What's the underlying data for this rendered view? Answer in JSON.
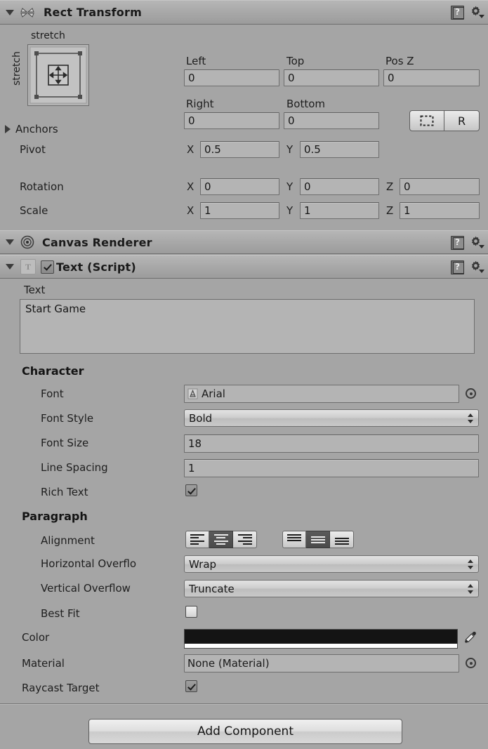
{
  "components": [
    {
      "id": "rect_transform",
      "title": "Rect Transform",
      "icon": "rect-transform-icon",
      "expanded": true,
      "help_icon": "help-book-icon",
      "gear_icon": "gear-icon"
    },
    {
      "id": "canvas_renderer",
      "title": "Canvas Renderer",
      "icon": "canvas-renderer-icon",
      "expanded": true,
      "help_icon": "help-book-icon",
      "gear_icon": "gear-icon"
    },
    {
      "id": "text_script",
      "title": "Text (Script)",
      "icon": "text-script-icon",
      "expanded": true,
      "enabled": true,
      "help_icon": "help-book-icon",
      "gear_icon": "gear-icon"
    }
  ],
  "rect_transform": {
    "anchor_preset": {
      "top_label": "stretch",
      "side_label": "stretch",
      "icon": "anchor-stretch-stretch-icon"
    },
    "left": {
      "label": "Left",
      "value": "0"
    },
    "top": {
      "label": "Top",
      "value": "0"
    },
    "pos_z": {
      "label": "Pos Z",
      "value": "0"
    },
    "right": {
      "label": "Right",
      "value": "0"
    },
    "bottom": {
      "label": "Bottom",
      "value": "0"
    },
    "blueprint_button": {
      "icon": "blueprint-rect-icon",
      "label": ""
    },
    "raw_button": {
      "label": "R"
    },
    "anchors": {
      "label": "Anchors",
      "expanded": false
    },
    "pivot": {
      "label": "Pivot",
      "x_axis": "X",
      "x": "0.5",
      "y_axis": "Y",
      "y": "0.5"
    },
    "rotation": {
      "label": "Rotation",
      "x_axis": "X",
      "x": "0",
      "y_axis": "Y",
      "y": "0",
      "z_axis": "Z",
      "z": "0"
    },
    "scale": {
      "label": "Scale",
      "x_axis": "X",
      "x": "1",
      "y_axis": "Y",
      "y": "1",
      "z_axis": "Z",
      "z": "1"
    }
  },
  "text_component": {
    "text_label": "Text",
    "text_value": "Start Game",
    "character_header": "Character",
    "font": {
      "label": "Font",
      "value": "Arial",
      "icon": "font-asset-icon",
      "picker_icon": "object-picker-icon"
    },
    "font_style": {
      "label": "Font Style",
      "value": "Bold",
      "dropdown_icon": "updown-arrow-icon"
    },
    "font_size": {
      "label": "Font Size",
      "value": "18"
    },
    "line_spacing": {
      "label": "Line Spacing",
      "value": "1"
    },
    "rich_text": {
      "label": "Rich Text",
      "checked": true
    },
    "paragraph_header": "Paragraph",
    "alignment": {
      "label": "Alignment",
      "horizontal_options": [
        "align-left",
        "align-center",
        "align-right"
      ],
      "horizontal_selected": 1,
      "vertical_options": [
        "align-top",
        "align-middle",
        "align-bottom"
      ],
      "vertical_selected": 1
    },
    "horizontal_overflow": {
      "label": "Horizontal Overflo",
      "value": "Wrap",
      "dropdown_icon": "updown-arrow-icon"
    },
    "vertical_overflow": {
      "label": "Vertical Overflow",
      "value": "Truncate",
      "dropdown_icon": "updown-arrow-icon"
    },
    "best_fit": {
      "label": "Best Fit",
      "checked": false
    },
    "color": {
      "label": "Color",
      "value": "#141414",
      "alpha": "#FFFFFF",
      "eyedropper_icon": "eyedropper-icon"
    },
    "material": {
      "label": "Material",
      "value": "None (Material)",
      "picker_icon": "object-picker-icon"
    },
    "raycast_target": {
      "label": "Raycast Target",
      "checked": true
    }
  },
  "footer": {
    "add_component": "Add Component"
  },
  "colors": {
    "background": "#a5a5a5",
    "header": "#b0b0b0",
    "field": "#b4b4b4",
    "text": "#1b1b1b"
  }
}
